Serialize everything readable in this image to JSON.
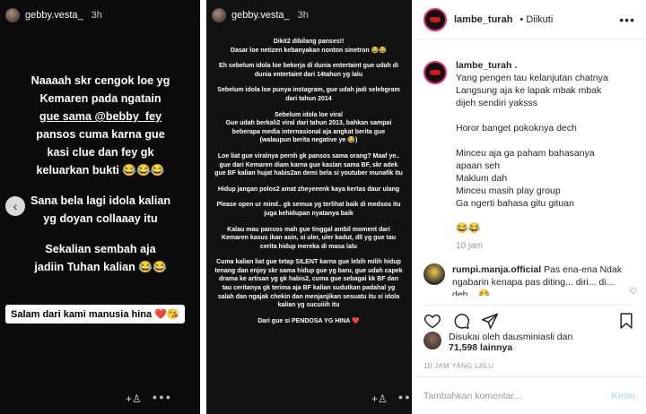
{
  "story_left": {
    "username": "gebby.vesta_",
    "time": "3h",
    "lines": [
      "Naaaah skr cengok loe yg",
      "Kemaren pada ngatain",
      "gue sama @bebby_fey",
      "pansos cuma karna gue",
      "kasi clue dan fey gk",
      "keluarkan bukti 😂😂😂",
      "",
      "Sana bela lagi idola kalian",
      "yg doyan collaaay itu",
      "",
      "Sekalian sembah aja",
      "jadiin Tuhan kalian 😂😂"
    ],
    "banner": "Salam dari kami manusia hina ❤️😘"
  },
  "story_right": {
    "username": "gebby.vesta_",
    "time": "3h",
    "paragraphs": [
      "Dikit2 dibilang panses!!\nDasar loe netizen kebanyakan nonton sinetron 😂😂",
      "Eh sebelum idola loe bekerja di dunia entertaint gue udah di dunia entertaint dari 14tahun yg lalu",
      "Sebelum idola loe punya instagram, gue udah jadi selebgram dari tahun 2014",
      "Sebelum idola loe viral\nGue udah berkali2 viral dari tahun 2013, bahkan sampai beberapa media internasional aja angkat berita gue\n(walaupun berita negative ye 😂)",
      "Loe liat gue viralnya pernh gk pansos sama orang? Maaf ye.. gue dari Kemaren diam karna gue kasian sama BF, skr adek gue BF kalian hujat habis2an demi bela si youtuber munafik itu",
      "Hidup jangan polos2 amat zheyeeenk kaya kertas daur ulang",
      "Please open ur mind.. gk semua yg terlihat baik di medsos itu juga kehidupan nyatanya baik",
      "Kalau mau pansos mah gue tinggal ambil moment dari Kemaren kasus ikan asin, si uler, uler kadut, dll yg gue tau cerita hidup mereka di masa lalu",
      "Cuma kalian liat gue tetap SILENT karna gue lebih milih hidup tenang dan enjoy skr sama hidup gue yg baru, gue udah capek drama ke artisan yg gk habis2, cuma gue sebagai kk BF dan tau ceritanya gk terima aja BF kalian sudutkan padahal yg salah dan ngajak chekin dan menjanjikan sesuatu itu si idola kalian yg sucuiiih itu",
      "Dari gue si PENDOSA YG HINA ❤️"
    ]
  },
  "panel": {
    "username": "lambe_turah",
    "follow_status": "• Diikuti",
    "more": "•••",
    "caption_lines": [
      "lambe_turah .",
      "Yang pengen tau kelanjutan chatnya",
      "Langsung aja ke lapak mbak mbak",
      "dijeh sendiri yaksss",
      "",
      "Horor banget pokoknya dech",
      "",
      "Minceu aja ga paham bahasanya",
      "apaan seh",
      "Maklum dah",
      "Minceu masih play group",
      "Ga ngerti bahasa gitu gituan",
      "",
      "😂😂"
    ],
    "caption_time": "10 jam",
    "comment": {
      "user": "rumpi.manja.official",
      "text": "Pas ena-ena Ndak ngabarin kenapa pas diting... diri... di... deh... 😂"
    },
    "likes_line1": "Disukai oleh dausminiasli dan",
    "likes_line2": "71,598 lainnya",
    "time_ago": "10 JAM YANG LALU",
    "add_comment_placeholder": "Tambahkan komentar...",
    "send_label": "Kirim"
  },
  "icons": {
    "heart": "heart-icon",
    "comment": "comment-icon",
    "share": "share-icon",
    "bookmark": "bookmark-icon"
  },
  "colors": {
    "story_bg": "#0b0b0b",
    "link_blue": "#b2dffc",
    "heart_red": "#e0245e"
  }
}
